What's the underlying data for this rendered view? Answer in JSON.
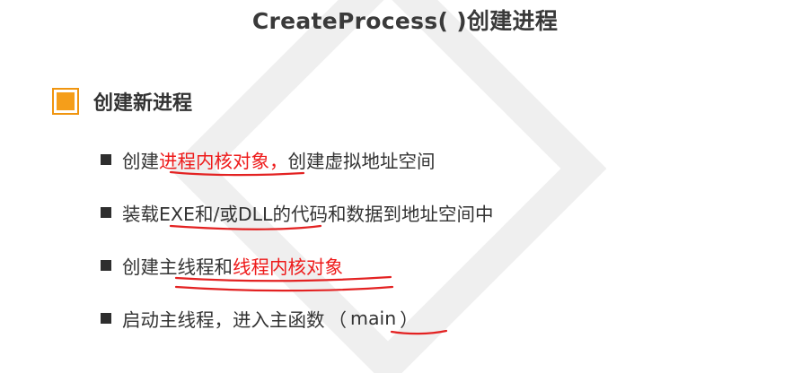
{
  "slide": {
    "title": "CreateProcess( )创建进程",
    "section": {
      "label": "创建新进程"
    },
    "bullets": [
      {
        "before": "创建",
        "red": "进程内核对象，",
        "after": "创建虚拟地址空间"
      },
      {
        "text": "装载EXE和/或DLL的代码和数据到地址空间中"
      },
      {
        "before": "创建主线程和",
        "red": "线程内核对象"
      },
      {
        "before": "启动主线程，进入主函数",
        "paren_open": "（",
        "main": "main",
        "paren_close": "）"
      }
    ]
  },
  "colors": {
    "accent": "#f59e1a",
    "highlight_red": "#ee1a1a",
    "text": "#333333",
    "watermark": "#eeeeee"
  },
  "icons": [
    "square-bullet-icon",
    "orange-square-icon",
    "diamond-watermark-icon"
  ]
}
